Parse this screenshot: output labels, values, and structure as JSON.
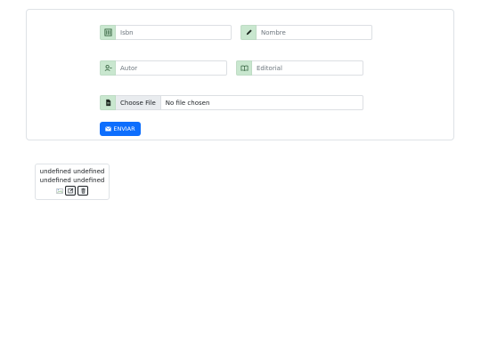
{
  "form": {
    "isbn": {
      "placeholder": "Isbn",
      "icon": "barcode-icon"
    },
    "nombre": {
      "placeholder": "Nombre",
      "icon": "pencil-icon"
    },
    "autor": {
      "placeholder": "Autor",
      "icon": "user-icon"
    },
    "editorial": {
      "placeholder": "Editorial",
      "icon": "book-icon"
    },
    "file": {
      "button_label": "Choose File",
      "status": "No file chosen",
      "icon": "file-icon"
    },
    "submit_label": "ENVIAR",
    "accent_color": "#0d6efd",
    "addon_color": "#c9e7cf"
  },
  "result": {
    "line1": "undefined undefined",
    "line2": "undefined undefined"
  }
}
